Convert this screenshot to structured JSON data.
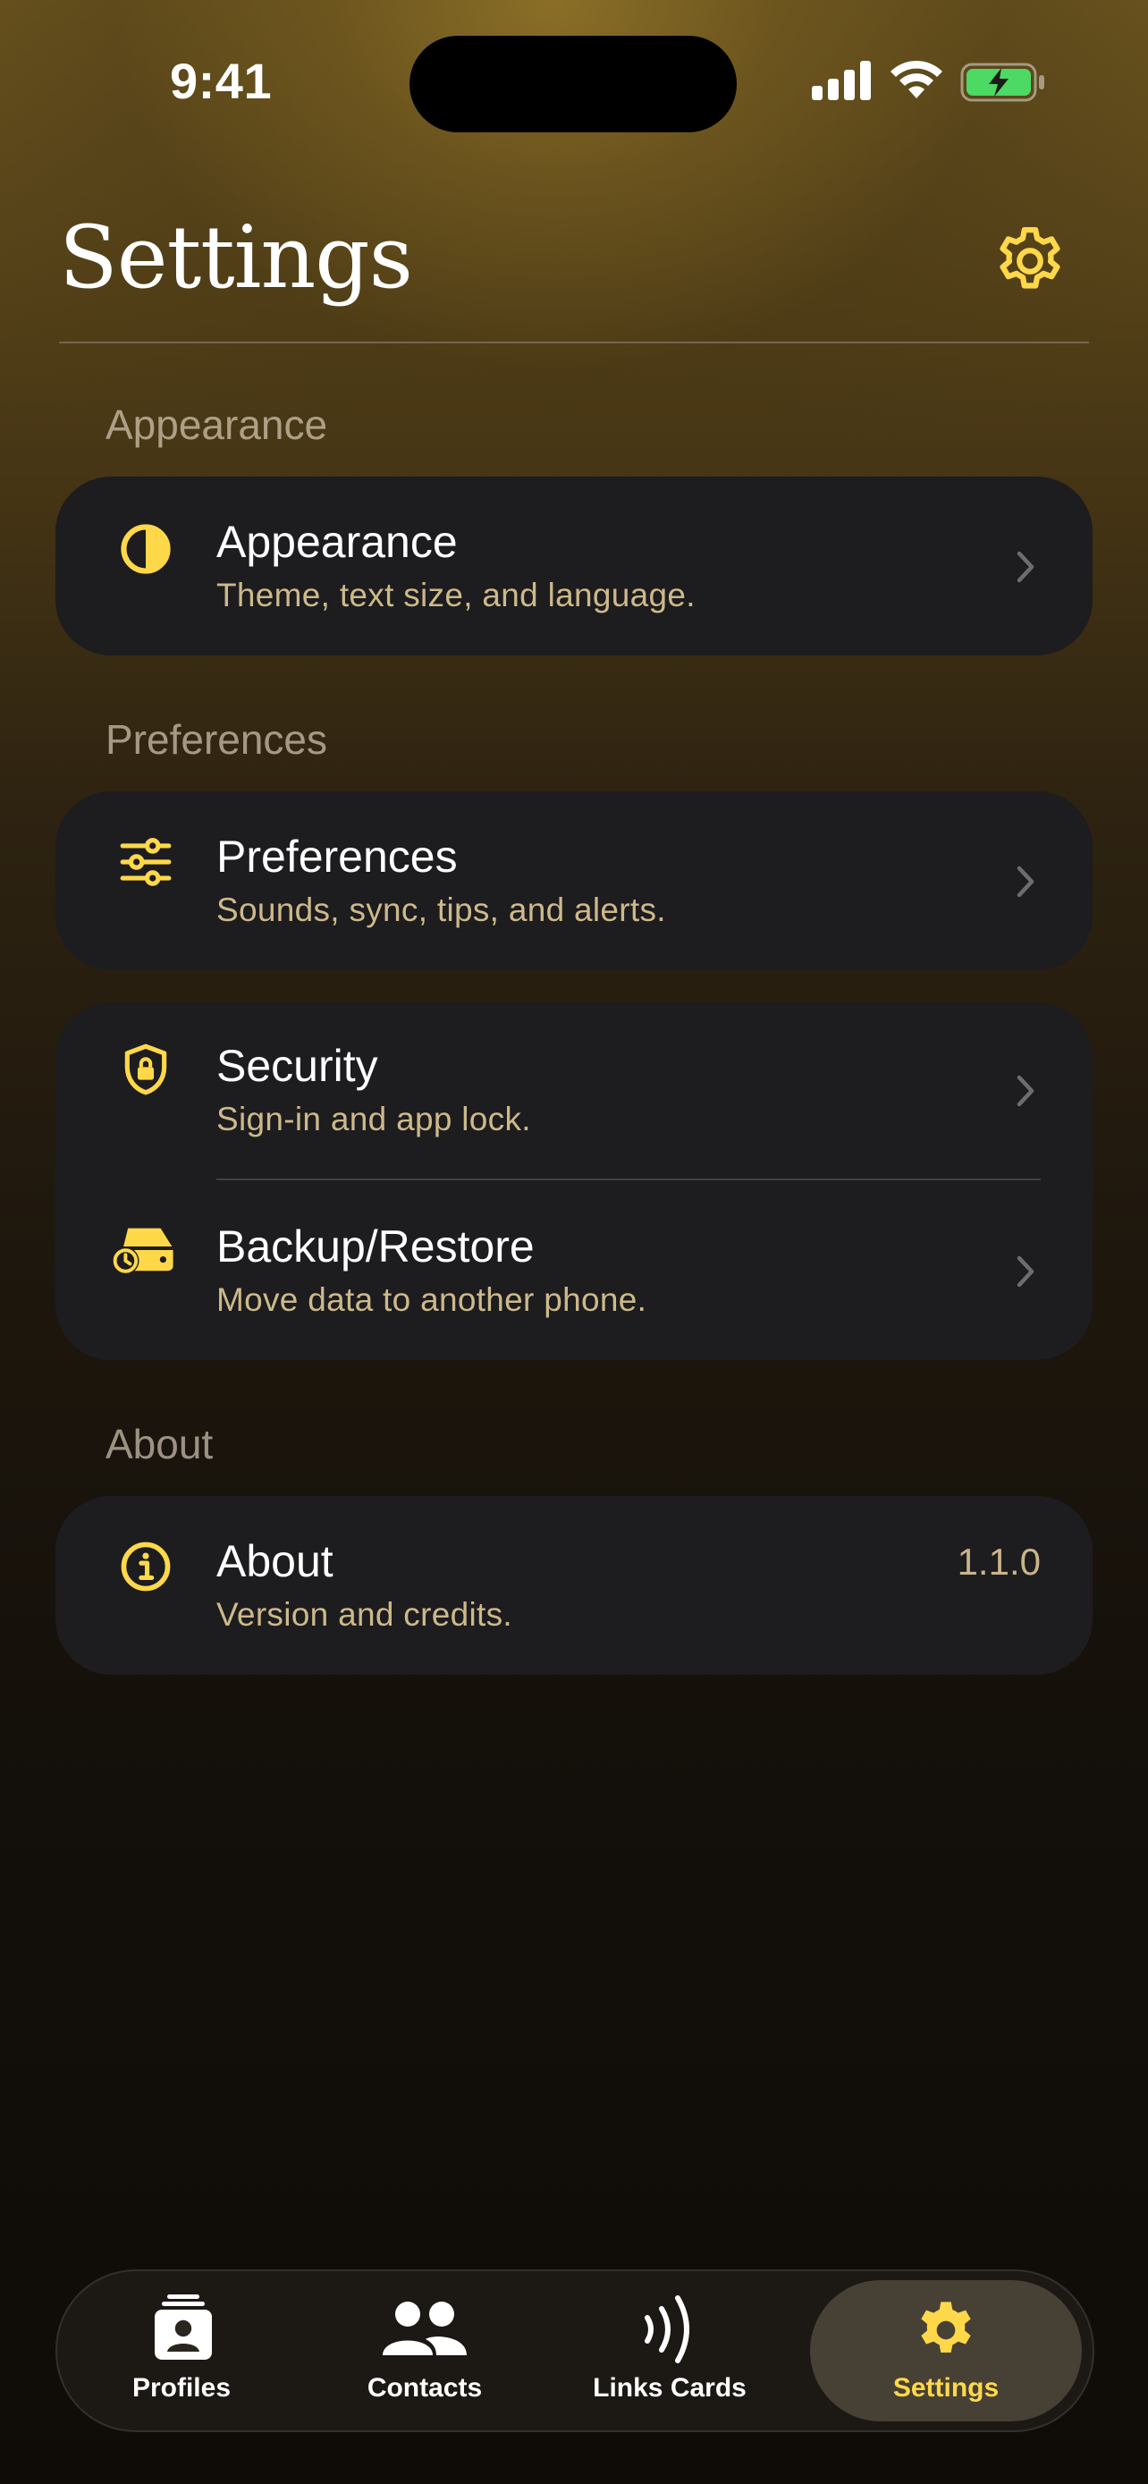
{
  "status": {
    "time": "9:41"
  },
  "header": {
    "title": "Settings"
  },
  "sections": {
    "appearance_label": "Appearance",
    "preferences_label": "Preferences",
    "about_label": "About"
  },
  "rows": {
    "appearance": {
      "title": "Appearance",
      "subtitle": "Theme, text size, and language."
    },
    "preferences": {
      "title": "Preferences",
      "subtitle": "Sounds, sync, tips, and alerts."
    },
    "security": {
      "title": "Security",
      "subtitle": "Sign-in and app lock."
    },
    "backup": {
      "title": "Backup/Restore",
      "subtitle": "Move data to another phone."
    },
    "about": {
      "title": "About",
      "subtitle": "Version and credits.",
      "value": "1.1.0"
    }
  },
  "tabs": [
    {
      "label": "Profiles",
      "icon": "profile-card-icon"
    },
    {
      "label": "Contacts",
      "icon": "people-icon"
    },
    {
      "label": "Links Cards",
      "icon": "nfc-waves-icon"
    },
    {
      "label": "Settings",
      "icon": "gear-icon",
      "active": true
    }
  ],
  "colors": {
    "accent": "#ffd84a",
    "card": "#1d1c1f",
    "subtitle": "#cdb98a",
    "battery": "#4cd964"
  }
}
